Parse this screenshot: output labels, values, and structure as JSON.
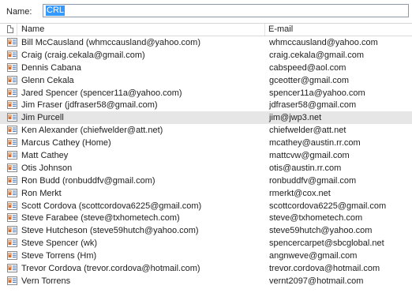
{
  "search": {
    "label": "Name:",
    "value": "CRL"
  },
  "columns": {
    "name": "Name",
    "email": "E-mail"
  },
  "colors": {
    "selection": "#3399ff",
    "selected_row": "#e6e6e6",
    "icon_card": "#d96b2b",
    "icon_lines": "#3a6fb8"
  },
  "contacts": [
    {
      "name": "Bill McCausland (whmccausland@yahoo.com)",
      "email": "whmccausland@yahoo.com"
    },
    {
      "name": "Craig (craig.cekala@gmail.com)",
      "email": "craig.cekala@gmail.com"
    },
    {
      "name": "Dennis Cabana",
      "email": "cabspeed@aol.com"
    },
    {
      "name": "Glenn Cekala",
      "email": "gceotter@gmail.com"
    },
    {
      "name": "Jared Spencer (spencer11a@yahoo.com)",
      "email": "spencer11a@yahoo.com"
    },
    {
      "name": "Jim Fraser (jdfraser58@gmail.com)",
      "email": "jdfraser58@gmail.com"
    },
    {
      "name": "Jim Purcell",
      "email": "jim@jwp3.net",
      "selected": true
    },
    {
      "name": "Ken Alexander (chiefwelder@att.net)",
      "email": "chiefwelder@att.net"
    },
    {
      "name": "Marcus Cathey (Home)",
      "email": "mcathey@austin.rr.com"
    },
    {
      "name": "Matt Cathey",
      "email": "mattcvw@gmail.com"
    },
    {
      "name": "Otis Johnson",
      "email": "otis@austin.rr.com"
    },
    {
      "name": "Ron Budd (ronbuddfv@gmail.com)",
      "email": "ronbuddfv@gmail.com"
    },
    {
      "name": "Ron Merkt",
      "email": "rmerkt@cox.net"
    },
    {
      "name": "Scott Cordova (scottcordova6225@gmail.com)",
      "email": "scottcordova6225@gmail.com"
    },
    {
      "name": "Steve Farabee (steve@txhometech.com)",
      "email": "steve@txhometech.com"
    },
    {
      "name": "Steve Hutcheson (steve59hutch@yahoo.com)",
      "email": "steve59hutch@yahoo.com"
    },
    {
      "name": "Steve Spencer (wk)",
      "email": "spencercarpet@sbcglobal.net"
    },
    {
      "name": "Steve Torrens (Hm)",
      "email": "angnweve@gmail.com"
    },
    {
      "name": "Trevor Cordova (trevor.cordova@hotmail.com)",
      "email": "trevor.cordova@hotmail.com"
    },
    {
      "name": "Vern Torrens",
      "email": "vernt2097@hotmail.com"
    }
  ]
}
